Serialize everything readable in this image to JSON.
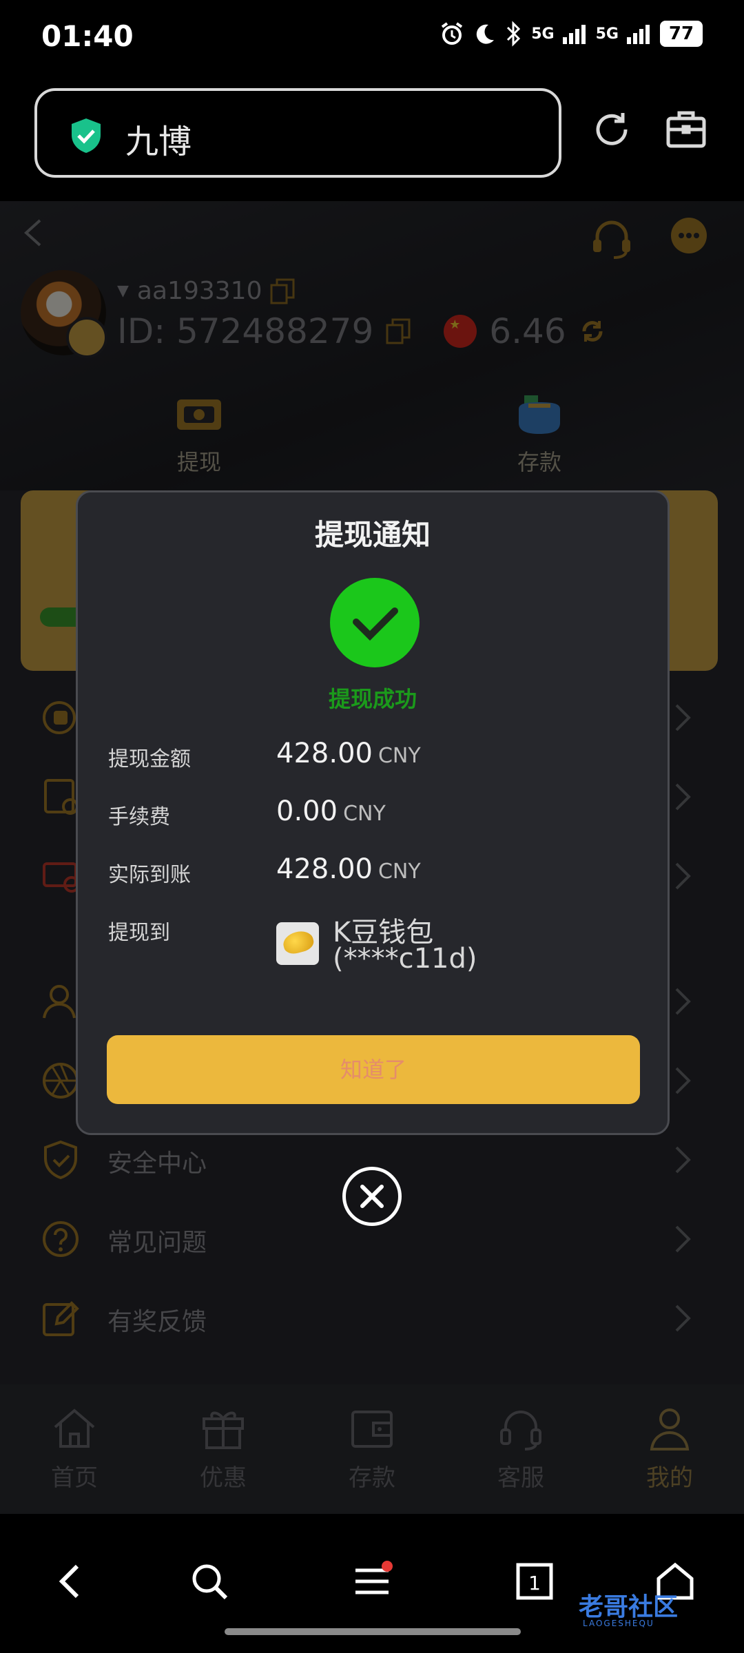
{
  "status_bar": {
    "time": "01:40",
    "signal_1": "5G",
    "signal_2": "5G",
    "battery": "77"
  },
  "browser": {
    "url_title": "九博"
  },
  "profile": {
    "username": "aa193310",
    "id_text": "ID: 572488279",
    "balance": "6.46"
  },
  "quick_actions": {
    "withdraw": "提现",
    "deposit": "存款"
  },
  "menu": {
    "items": [
      {
        "label": ""
      },
      {
        "label": ""
      },
      {
        "label": ""
      },
      {
        "label": ""
      },
      {
        "label": ""
      },
      {
        "label": "安全中心"
      },
      {
        "label": "常见问题"
      },
      {
        "label": "有奖反馈"
      }
    ]
  },
  "tabbar": {
    "home": "首页",
    "promo": "优惠",
    "deposit": "存款",
    "support": "客服",
    "mine": "我的"
  },
  "dialog": {
    "title": "提现通知",
    "status": "提现成功",
    "rows": [
      {
        "label": "提现金额",
        "value": "428.00",
        "unit": "CNY"
      },
      {
        "label": "手续费",
        "value": "0.00",
        "unit": "CNY"
      },
      {
        "label": "实际到账",
        "value": "428.00",
        "unit": "CNY"
      }
    ],
    "dest_label": "提现到",
    "wallet_name": "K豆钱包",
    "wallet_account": "(****c11d)",
    "ok_button": "知道了"
  },
  "watermark": {
    "text": "老哥社区",
    "sub": "LAOGESHEQU"
  },
  "colors": {
    "accent_gold": "#ecb83d",
    "success_green": "#1bc71b",
    "page_bg": "#26272c"
  }
}
